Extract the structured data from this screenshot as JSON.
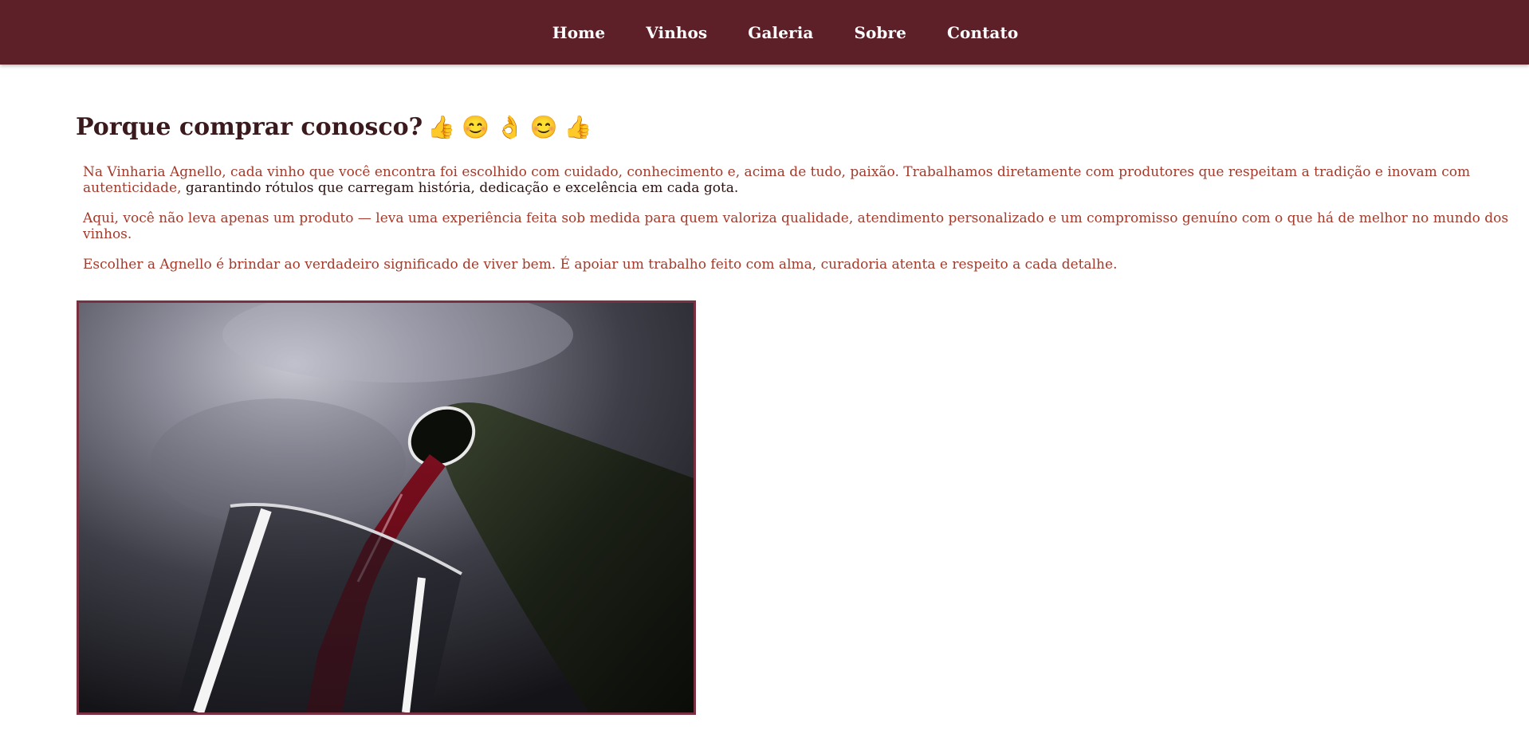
{
  "nav": {
    "items": [
      {
        "label": "Home"
      },
      {
        "label": "Vinhos"
      },
      {
        "label": "Galeria"
      },
      {
        "label": "Sobre"
      },
      {
        "label": "Contato"
      }
    ]
  },
  "main": {
    "title": "Porque comprar conosco?",
    "title_emojis": [
      "👍",
      "😊",
      "👌",
      "😊",
      "👍"
    ],
    "paragraphs": [
      {
        "text_accent": "Na Vinharia Agnello, cada vinho que você encontra foi escolhido com cuidado, conhecimento e, acima de tudo, paixão. Trabalhamos diretamente com produtores que respeitam a tradição e inovam com autenticidade,",
        "text_dark": " garantindo rótulos que carregam história, dedicação e excelência em cada gota."
      },
      {
        "text": "Aqui, você não leva apenas um produto — leva uma experiência feita sob medida para quem valoriza qualidade, atendimento personalizado e um compromisso genuíno com o que há de melhor no mundo dos vinhos."
      },
      {
        "text": "Escolher a Agnello é brindar ao verdadeiro significado de viver bem. É apoiar um trabalho feito com alma, curadoria atenta e respeito a cada detalhe."
      }
    ]
  },
  "colors": {
    "navbar_bg": "#5e2028",
    "nav_text": "#ffffff",
    "title_text": "#3a1a1c",
    "paragraph_accent": "#a33a2b",
    "paragraph_dark": "#2a1212",
    "image_border": "#7a3040"
  }
}
